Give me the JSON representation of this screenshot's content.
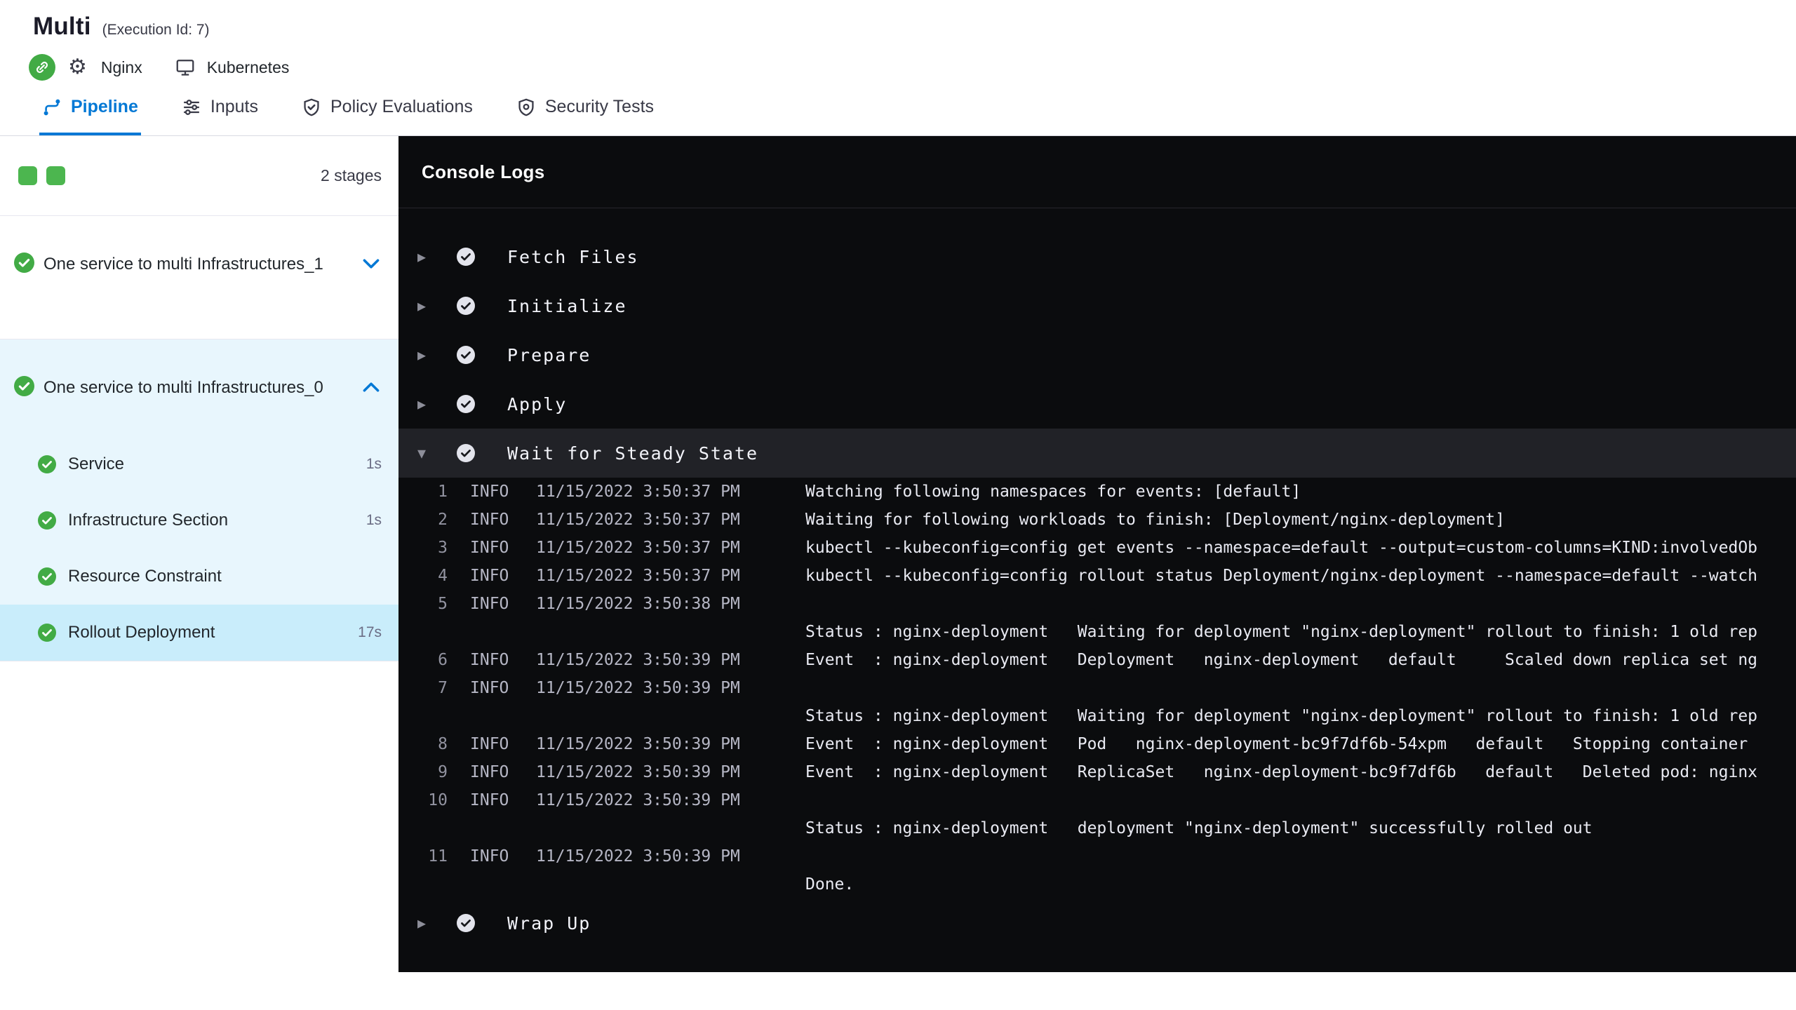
{
  "header": {
    "title": "Multi",
    "execution_id": "(Execution Id: 7)",
    "service_label": "Nginx",
    "infra_label": "Kubernetes"
  },
  "tabs": [
    {
      "label": "Pipeline",
      "active": true
    },
    {
      "label": "Inputs",
      "active": false
    },
    {
      "label": "Policy Evaluations",
      "active": false
    },
    {
      "label": "Security Tests",
      "active": false
    }
  ],
  "sidebar": {
    "stage_count": "2 stages",
    "stages": [
      {
        "name": "One service to multi Infrastructures_1",
        "status": "success",
        "expanded": false
      },
      {
        "name": "One service to multi Infrastructures_0",
        "status": "success",
        "expanded": true,
        "steps": [
          {
            "label": "Service",
            "duration": "1s",
            "status": "success"
          },
          {
            "label": "Infrastructure Section",
            "duration": "1s",
            "status": "success"
          },
          {
            "label": "Resource Constraint",
            "duration": "",
            "status": "success"
          },
          {
            "label": "Rollout Deployment",
            "duration": "17s",
            "status": "success",
            "selected": true
          }
        ]
      }
    ]
  },
  "console": {
    "title": "Console Logs",
    "steps_before": [
      "Fetch Files",
      "Initialize",
      "Prepare",
      "Apply"
    ],
    "expanded_step": "Wait for Steady State",
    "steps_after": [
      "Wrap Up"
    ],
    "log_rows": [
      {
        "num": "1",
        "level": "INFO",
        "time": "11/15/2022 3:50:37 PM",
        "msg": "Watching following namespaces for events: [default]"
      },
      {
        "num": "2",
        "level": "INFO",
        "time": "11/15/2022 3:50:37 PM",
        "msg": "Waiting for following workloads to finish: [Deployment/nginx-deployment]"
      },
      {
        "num": "3",
        "level": "INFO",
        "time": "11/15/2022 3:50:37 PM",
        "msg": "kubectl --kubeconfig=config get events --namespace=default --output=custom-columns=KIND:involvedOb"
      },
      {
        "num": "4",
        "level": "INFO",
        "time": "11/15/2022 3:50:37 PM",
        "msg": "kubectl --kubeconfig=config rollout status Deployment/nginx-deployment --namespace=default --watch"
      },
      {
        "num": "5",
        "level": "INFO",
        "time": "11/15/2022 3:50:38 PM",
        "msg": ""
      },
      {
        "msg": "Status : nginx-deployment   Waiting for deployment \"nginx-deployment\" rollout to finish: 1 old rep"
      },
      {
        "num": "6",
        "level": "INFO",
        "time": "11/15/2022 3:50:39 PM",
        "msg": "Event  : nginx-deployment   Deployment   nginx-deployment   default     Scaled down replica set ng"
      },
      {
        "num": "7",
        "level": "INFO",
        "time": "11/15/2022 3:50:39 PM",
        "msg": ""
      },
      {
        "msg": "Status : nginx-deployment   Waiting for deployment \"nginx-deployment\" rollout to finish: 1 old rep"
      },
      {
        "num": "8",
        "level": "INFO",
        "time": "11/15/2022 3:50:39 PM",
        "msg": "Event  : nginx-deployment   Pod   nginx-deployment-bc9f7df6b-54xpm   default   Stopping container"
      },
      {
        "num": "9",
        "level": "INFO",
        "time": "11/15/2022 3:50:39 PM",
        "msg": "Event  : nginx-deployment   ReplicaSet   nginx-deployment-bc9f7df6b   default   Deleted pod: nginx"
      },
      {
        "num": "10",
        "level": "INFO",
        "time": "11/15/2022 3:50:39 PM",
        "msg": ""
      },
      {
        "msg": "Status : nginx-deployment   deployment \"nginx-deployment\" successfully rolled out"
      },
      {
        "num": "11",
        "level": "INFO",
        "time": "11/15/2022 3:50:39 PM",
        "msg": ""
      },
      {
        "msg": "Done."
      }
    ]
  },
  "colors": {
    "accent_blue": "#0278d5",
    "success_green": "#42ab45",
    "console_bg": "#0b0c0e",
    "expanded_step_row_bg": "#212227",
    "selected_step_bg": "#c9edfb",
    "expanded_stage_bg": "#e8f6fd"
  }
}
